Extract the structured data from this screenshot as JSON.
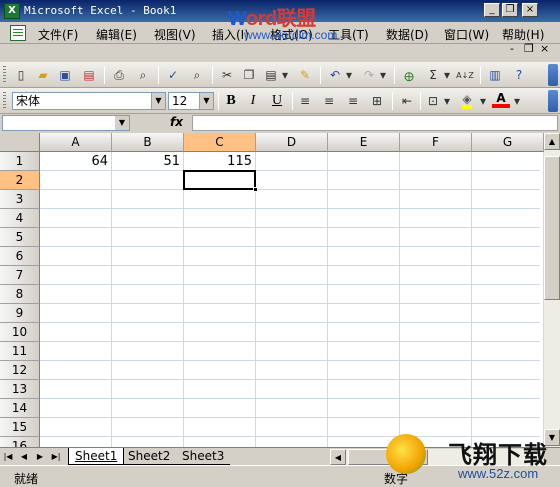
{
  "window": {
    "title": "Microsoft Excel - Book1",
    "minimize_glyph": "_",
    "restore_glyph": "❐",
    "close_glyph": "×"
  },
  "watermark": {
    "prefix": "W",
    "rest": "ord联盟",
    "url": "www.wordlm.com"
  },
  "menubar": {
    "items": [
      "文件(F)",
      "编辑(E)",
      "视图(V)",
      "插入(I)",
      "格式(O)",
      "工具(T)",
      "数据(D)",
      "窗口(W)",
      "帮助(H)"
    ],
    "doc_min_glyph": "-",
    "doc_restore_glyph": "❐",
    "doc_close_glyph": "×"
  },
  "toolbar": {
    "font_name": "宋体",
    "font_size": "12",
    "bold": "B",
    "italic": "I",
    "underline": "U",
    "sigma": "Σ",
    "sort_label": "A↓Z",
    "font_color_label": "A",
    "colors": {
      "fill": "#ffff00",
      "font": "#ff0000"
    }
  },
  "formulabar": {
    "namebox_value": "",
    "fx_label": "fx",
    "formula": ""
  },
  "grid": {
    "columns": [
      "A",
      "B",
      "C",
      "D",
      "E",
      "F",
      "G"
    ],
    "selected_column": "C",
    "rows": [
      "1",
      "2",
      "3",
      "4",
      "5",
      "6",
      "7",
      "8",
      "9",
      "10",
      "11",
      "12",
      "13",
      "14",
      "15",
      "16"
    ],
    "selected_row": "2",
    "cells": {
      "A1": "64",
      "B1": "51",
      "C1": "115"
    },
    "active_cell": "C2"
  },
  "sheets": {
    "tabs": [
      "Sheet1",
      "Sheet2",
      "Sheet3"
    ],
    "active": "Sheet1"
  },
  "status": {
    "ready": "就绪",
    "mode": "数字"
  },
  "logo": {
    "text": "飞翔下载",
    "url": "www.52z.com"
  }
}
